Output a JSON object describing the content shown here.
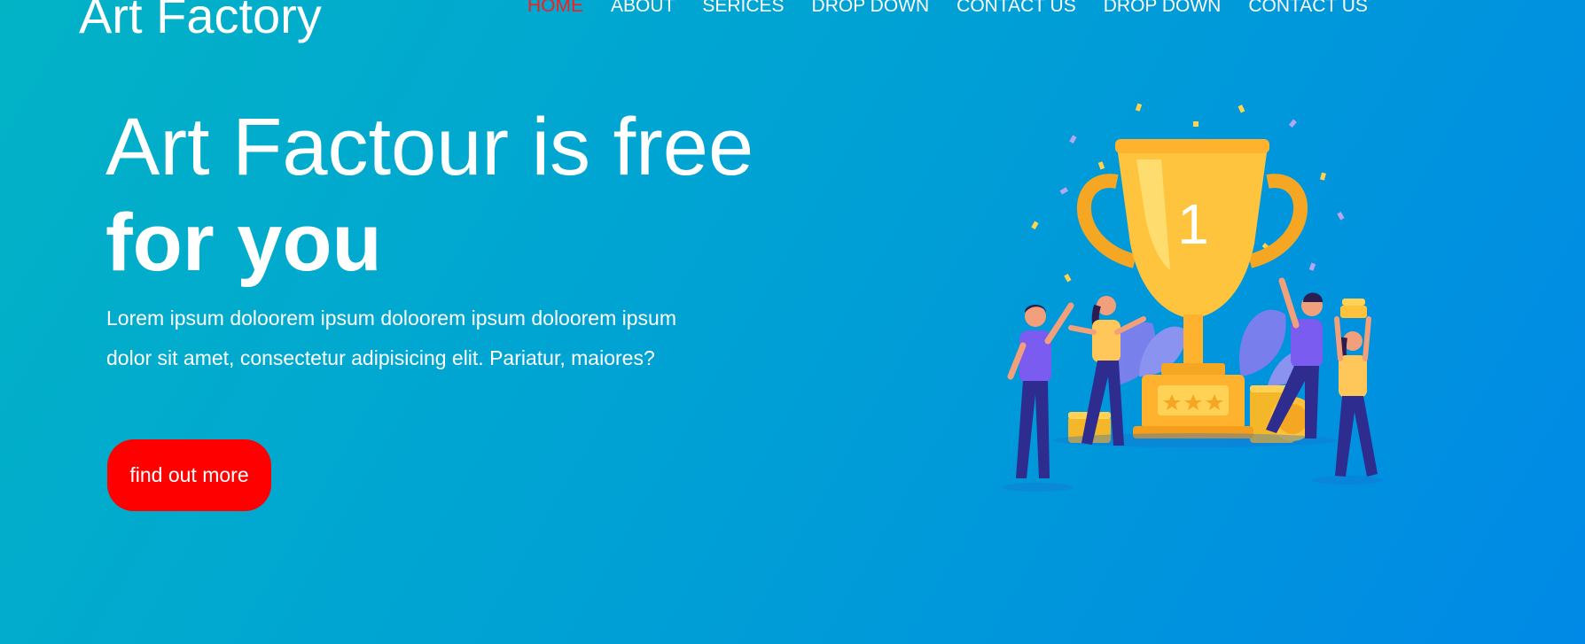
{
  "brand": {
    "logo_text": "Art Factory"
  },
  "nav": {
    "items": [
      {
        "label": "HOME",
        "active": true
      },
      {
        "label": "ABOUT"
      },
      {
        "label": "SERICES"
      },
      {
        "label": "DROP DOWN"
      },
      {
        "label": "CONTACT US"
      },
      {
        "label": "DROP DOWN"
      },
      {
        "label": "CONTACT US"
      }
    ]
  },
  "hero": {
    "title_line1": "Art Factour is free",
    "title_line2": "for you",
    "paragraph": "Lorem ipsum doloorem ipsum doloorem ipsum doloorem ipsum dolor sit amet, consectetur adipisicing elit. Pariatur, maiores?",
    "cta_label": "find out more",
    "trophy_number": "1"
  },
  "colors": {
    "gradient_start": "#02b3c6",
    "gradient_end": "#0089e6",
    "active_nav": "#ff1a1a",
    "cta_bg": "#ff0000",
    "trophy": "#ffc43d"
  }
}
